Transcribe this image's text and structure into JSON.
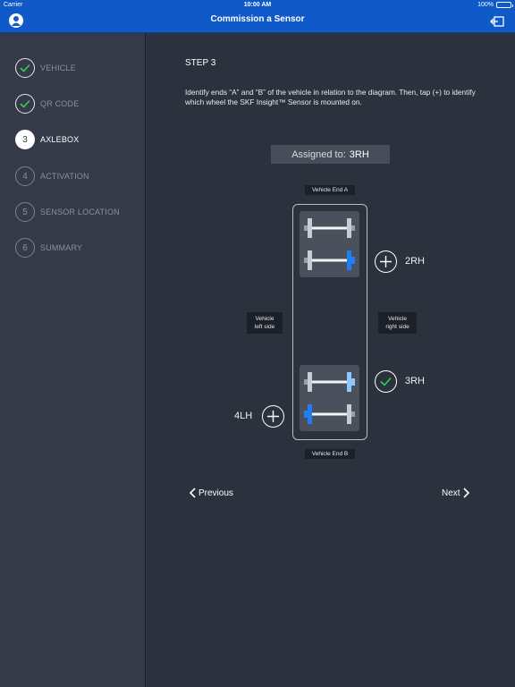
{
  "status": {
    "carrier": "Carrier",
    "time": "10:00 AM",
    "battery": "100%"
  },
  "nav": {
    "title": "Commission a Sensor"
  },
  "sidebar": {
    "steps": [
      {
        "number": "1",
        "label": "VEHICLE",
        "state": "done"
      },
      {
        "number": "2",
        "label": "QR CODE",
        "state": "done"
      },
      {
        "number": "3",
        "label": "AXLEBOX",
        "state": "active"
      },
      {
        "number": "4",
        "label": "ACTIVATION",
        "state": "pending"
      },
      {
        "number": "5",
        "label": "SENSOR LOCATION",
        "state": "pending"
      },
      {
        "number": "6",
        "label": "SUMMARY",
        "state": "pending"
      }
    ]
  },
  "main": {
    "step_title": "STEP 3",
    "instructions": "Identify ends “A” and “B” of the vehicle in relation to the diagram. Then, tap (+) to identify which wheel the SKF Insight™ Sensor is mounted on.",
    "assigned_label": "Assigned to:",
    "assigned_value": "3RH",
    "vehicle_end_a": "Vehicle End A",
    "vehicle_end_b": "Vehicle End B",
    "left_side_line1": "Vehicle",
    "left_side_line2": "left side",
    "right_side_line1": "Vehicle",
    "right_side_line2": "right side",
    "wheels": {
      "w2rh": "2RH",
      "w3rh": "3RH",
      "w4lh": "4LH"
    },
    "previous_label": "Previous",
    "next_label": "Next"
  },
  "colors": {
    "accent": "#0f59c9",
    "highlight_blue": "#1f7ef5",
    "assigned_green": "#35d14a"
  }
}
